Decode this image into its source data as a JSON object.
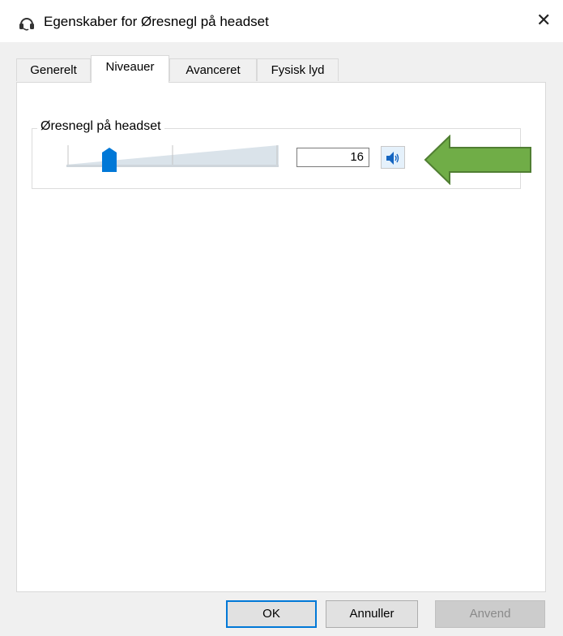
{
  "window": {
    "title": "Egenskaber for Øresnegl på headset",
    "icon": "headset-icon",
    "close_glyph": "✕"
  },
  "tabs": [
    {
      "label": "Generelt",
      "active": false
    },
    {
      "label": "Niveauer",
      "active": true
    },
    {
      "label": "Avanceret",
      "active": false
    },
    {
      "label": "Fysisk lyd",
      "active": false
    }
  ],
  "levels": {
    "group_label": "Øresnegl på headset",
    "volume_value": "16",
    "slider_level": 0.16,
    "mute_icon": "speaker-icon"
  },
  "annotation": {
    "icon": "green-arrow-icon",
    "color": "#70ad47"
  },
  "buttons": {
    "ok": "OK",
    "cancel": "Annuller",
    "apply": "Anvend"
  },
  "colors": {
    "accent": "#0078d7",
    "arrow_fill": "#70ad47",
    "arrow_stroke": "#507e32"
  }
}
